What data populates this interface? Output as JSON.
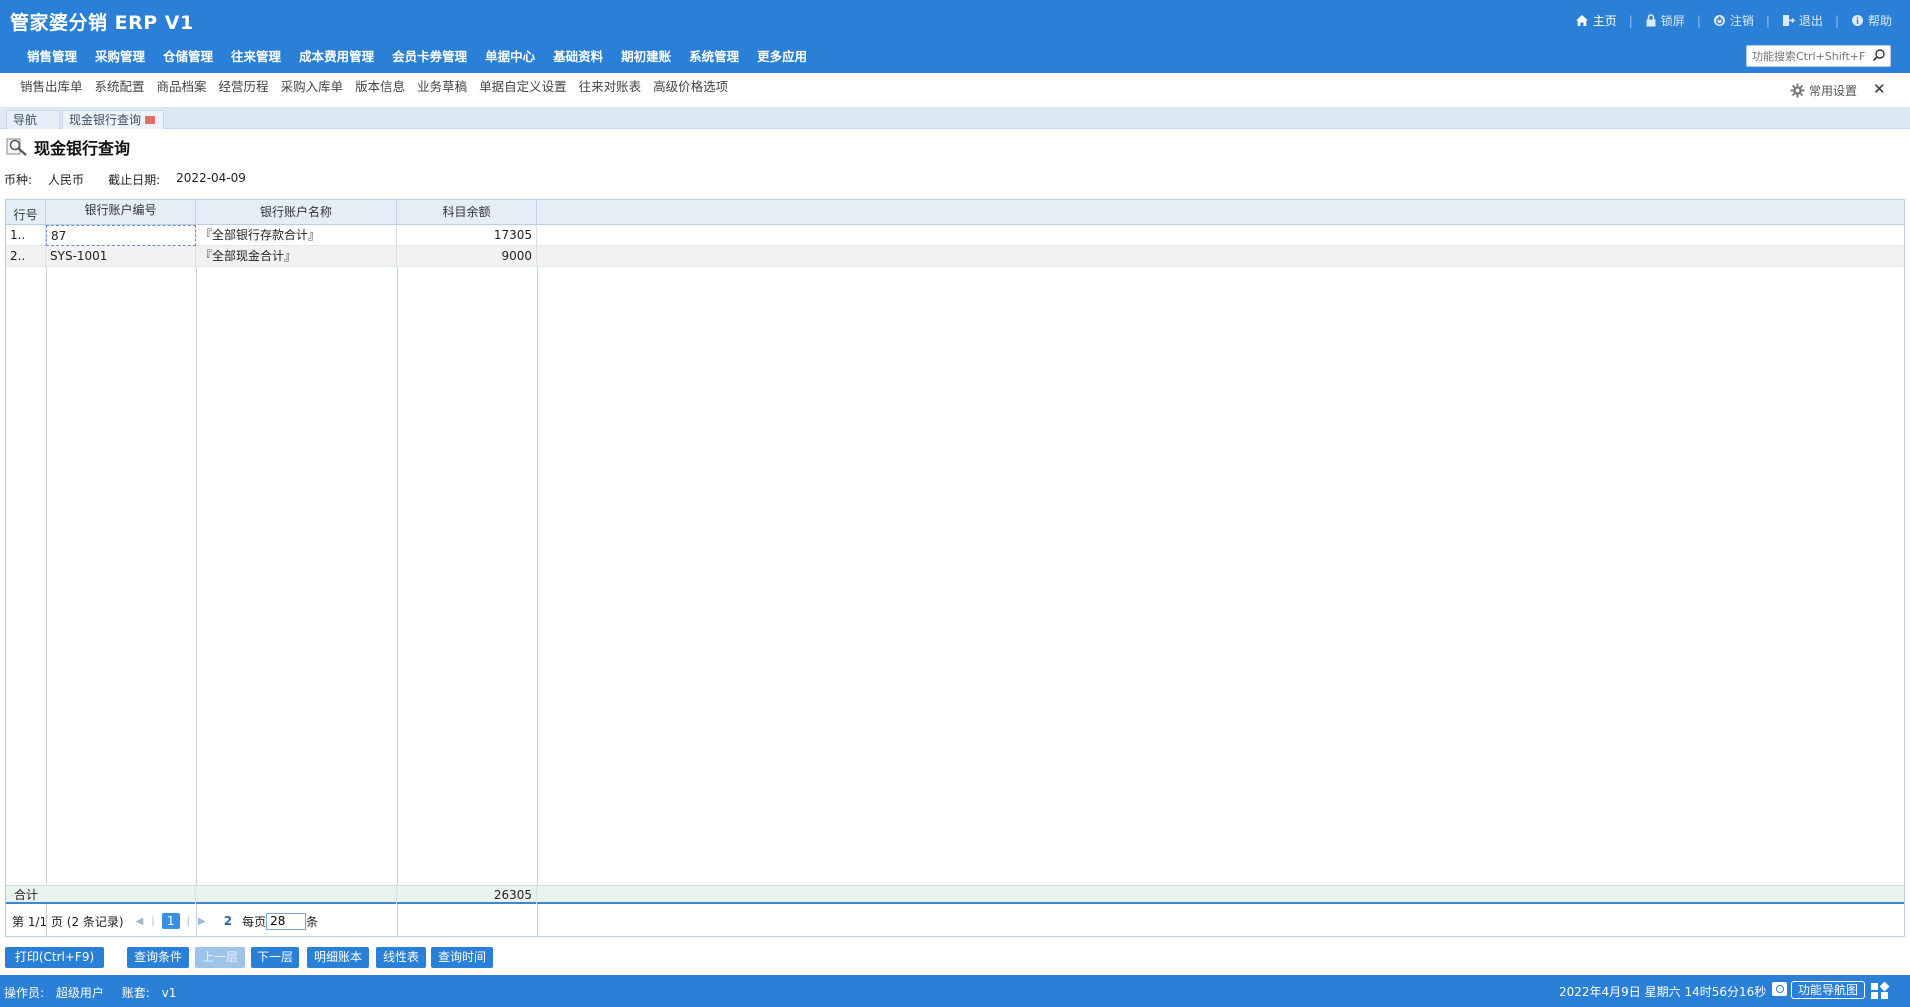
{
  "app": {
    "title": "管家婆分销 ERP V1"
  },
  "top_links": [
    {
      "label": "主页",
      "icon": "home-icon"
    },
    {
      "label": "锁屏",
      "icon": "lock-icon"
    },
    {
      "label": "注销",
      "icon": "power-icon"
    },
    {
      "label": "退出",
      "icon": "exit-icon"
    },
    {
      "label": "帮助",
      "icon": "info-icon"
    }
  ],
  "main_nav": [
    "销售管理",
    "采购管理",
    "仓储管理",
    "往来管理",
    "成本费用管理",
    "会员卡券管理",
    "单据中心",
    "基础资料",
    "期初建账",
    "系统管理",
    "更多应用"
  ],
  "search": {
    "placeholder": "功能搜索Ctrl+Shift+F"
  },
  "quick_links": [
    "销售出库单",
    "系统配置",
    "商品档案",
    "经营历程",
    "采购入库单",
    "版本信息",
    "业务草稿",
    "单据自定义设置",
    "往来对账表",
    "高级价格选项"
  ],
  "settings_label": "常用设置",
  "tabs": {
    "nav": "导航",
    "active": "现金银行查询"
  },
  "page": {
    "title": "现金银行查询",
    "currency_label": "币种:",
    "currency_value": "人民币",
    "date_label": "截止日期:",
    "date_value": "2022-04-09"
  },
  "table": {
    "headers": [
      "行号",
      "银行账户编号",
      "银行账户名称",
      "科目余额"
    ],
    "rows": [
      {
        "no": "1..",
        "code": "87",
        "name": "『全部银行存款合计』",
        "balance": "17305"
      },
      {
        "no": "2..",
        "code": "SYS-1001",
        "name": "『全部现金合计』",
        "balance": "9000"
      }
    ],
    "total_label": "合计",
    "total_value": "26305"
  },
  "pager": {
    "page_info": "第 1/1 页 (2 条记录)",
    "current_page": "1",
    "next_page": "2",
    "per_page_label": "每页",
    "per_page_value": "28",
    "unit": "条"
  },
  "actions": {
    "print": "打印(Ctrl+F9)",
    "query_cond": "查询条件",
    "up_level": "上一层",
    "down_level": "下一层",
    "detail_ledger": "明细账本",
    "line_chart": "线性表",
    "query_time": "查询时间"
  },
  "footer": {
    "operator_label": "操作员:",
    "operator_value": "超级用户",
    "account_label": "账套:",
    "account_value": "v1",
    "clock": "2022年4月9日  星期六  14时56分16秒",
    "fn_nav": "功能导航图"
  },
  "colors": {
    "brand": "#2a7fd6",
    "header_bg": "#2a7fd6",
    "grid_header": "#e5eef7"
  }
}
